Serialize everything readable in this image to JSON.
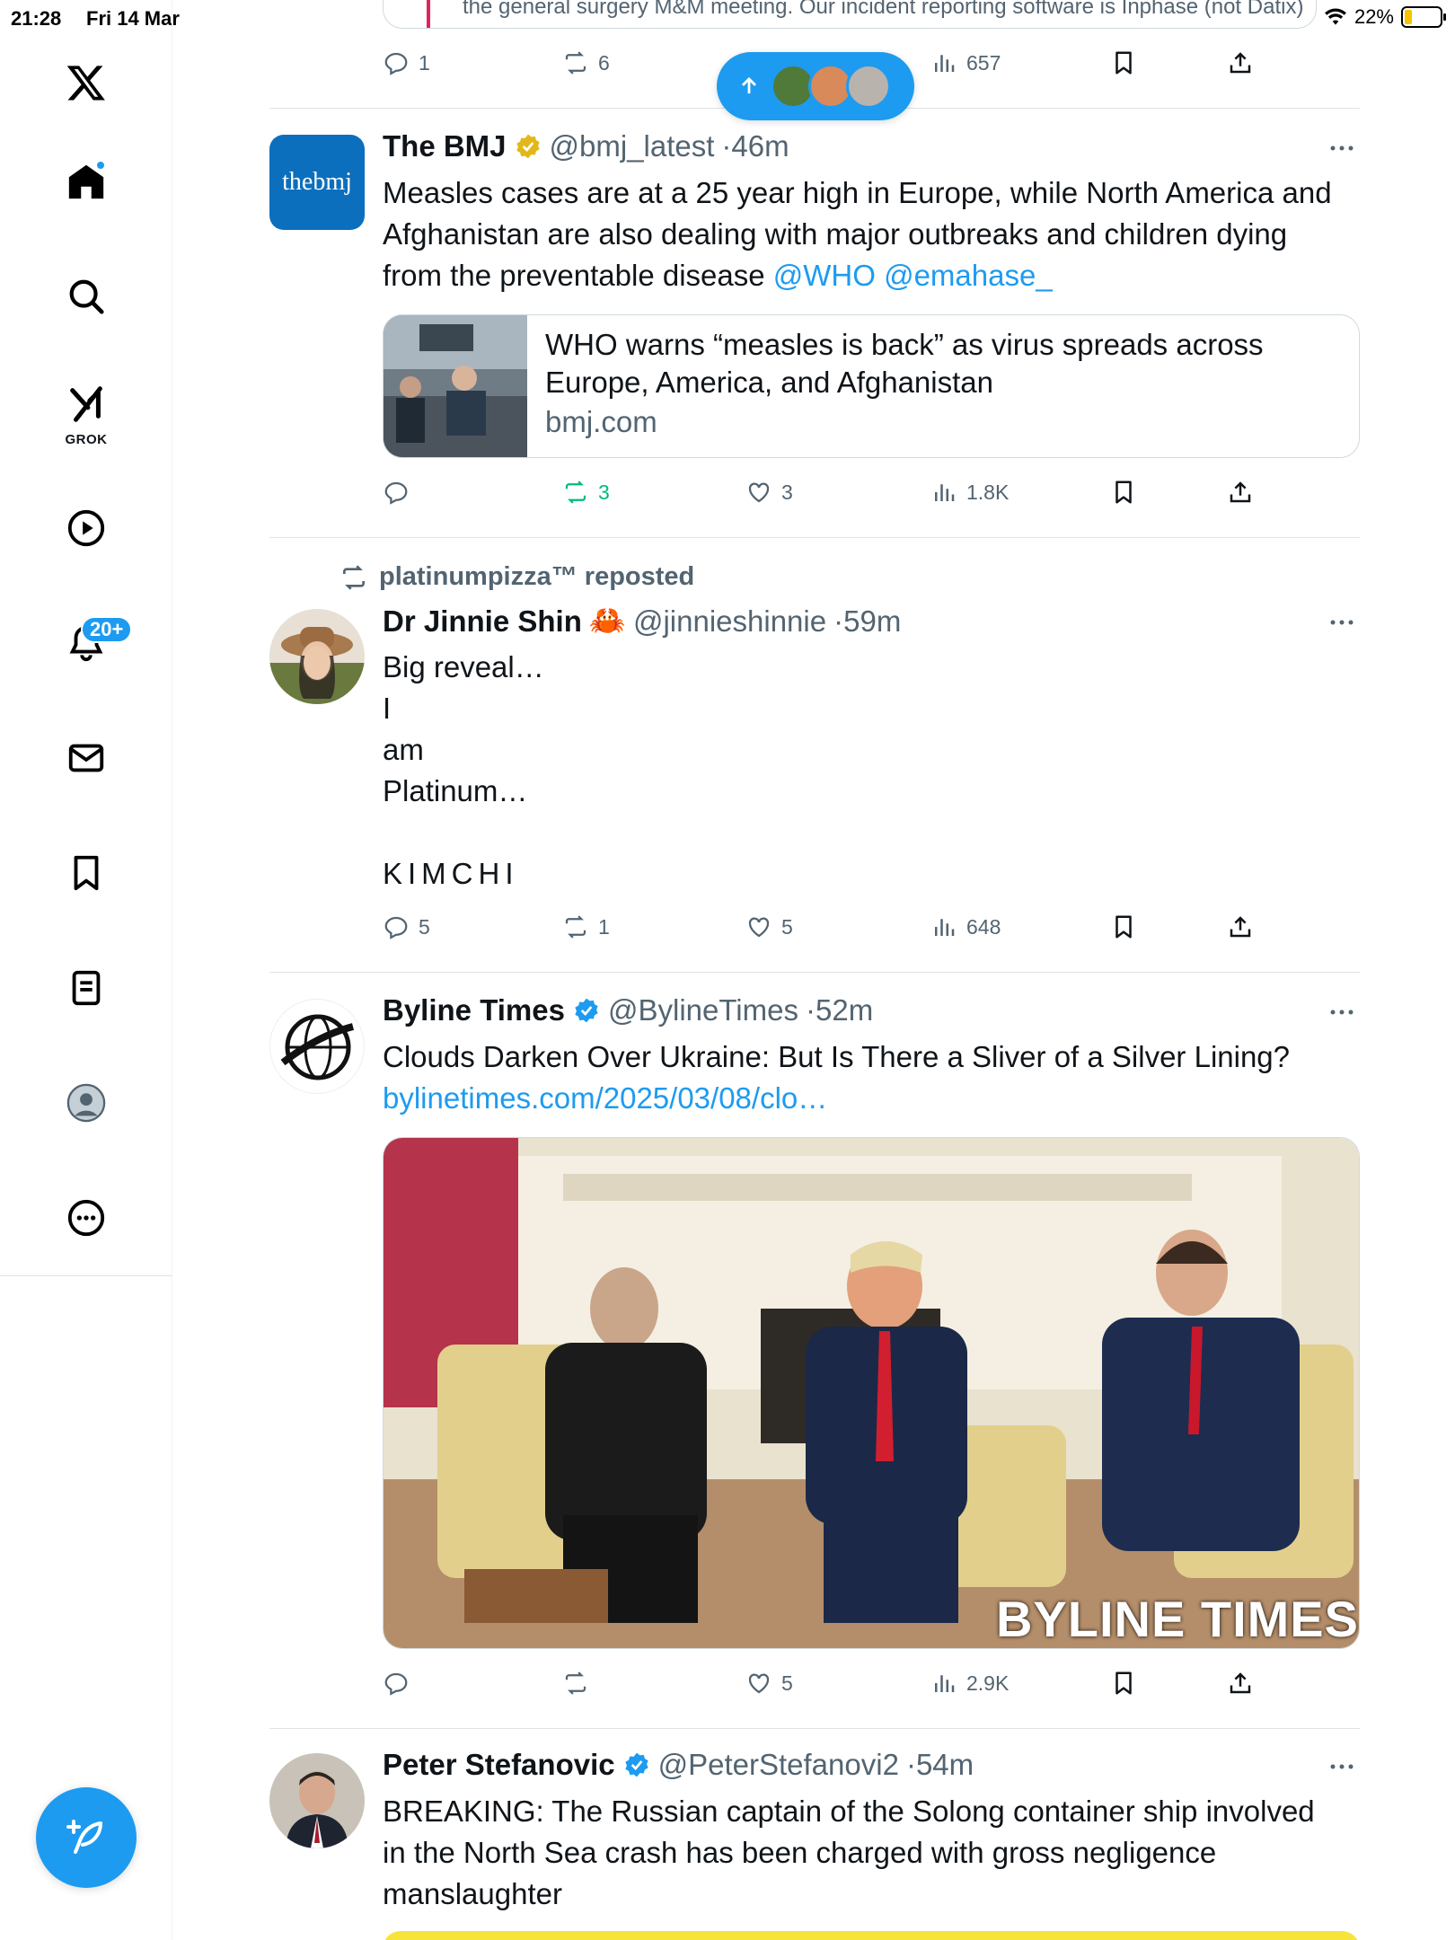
{
  "status_bar": {
    "time": "21:28",
    "date": "Fri 14 Mar",
    "battery": "22%"
  },
  "sidebar": {
    "logo": "x-logo",
    "items": [
      {
        "name": "home",
        "icon": "home-icon"
      },
      {
        "name": "search",
        "icon": "search-icon"
      },
      {
        "name": "grok",
        "icon": "grok-icon",
        "label": "GROK"
      },
      {
        "name": "video",
        "icon": "play-icon"
      },
      {
        "name": "notifications",
        "icon": "bell-icon",
        "badge": "20+"
      },
      {
        "name": "messages",
        "icon": "mail-icon"
      },
      {
        "name": "bookmarks",
        "icon": "bookmark-icon"
      },
      {
        "name": "lists",
        "icon": "list-icon"
      },
      {
        "name": "profile",
        "icon": "profile-icon"
      },
      {
        "name": "more",
        "icon": "more-circle-icon"
      }
    ],
    "compose_icon": "compose-icon"
  },
  "top_tweet": {
    "quote_text": "the general surgery M&M meeting. Our incident reporting software is Inphase (not Datix)",
    "replies": "1",
    "reposts": "6",
    "views": "657"
  },
  "new_posts_pill": {
    "icon": "arrow-up-icon"
  },
  "tweets": [
    {
      "name": "The BMJ",
      "verified": "gold",
      "handle": "@bmj_latest",
      "time": "46m",
      "avatar_text": "thebmj",
      "text_lines": [
        "Measles cases are at a 25 year high in Europe, while North America and",
        "Afghanistan are also dealing with major outbreaks and children dying",
        "from the preventable disease "
      ],
      "mentions": "@WHO @emahase_",
      "card": {
        "title": "WHO warns “measles is back” as virus spreads across Europe, America, and Afghanistan",
        "domain": "bmj.com"
      },
      "replies": "",
      "reposts": "3",
      "likes": "3",
      "views": "1.8K"
    },
    {
      "repost_by": "platinumpizza™ reposted",
      "name": "Dr Jinnie Shin",
      "emoji": "🦀",
      "handle": "@jinnieshinnie",
      "time": "59m",
      "text_lines": [
        "Big reveal…",
        "I",
        "am",
        "Platinum…",
        "",
        "KIMCHI"
      ],
      "replies": "5",
      "reposts": "1",
      "likes": "5",
      "views": "648"
    },
    {
      "name": "Byline Times",
      "verified": "blue",
      "handle": "@BylineTimes",
      "time": "52m",
      "text": "Clouds Darken Over Ukraine: But Is There a Sliver of a Silver Lining?",
      "link": "bylinetimes.com/2025/03/08/clo…",
      "media_watermark": "BYLINE TIMES",
      "replies": "",
      "reposts": "",
      "likes": "5",
      "views": "2.9K"
    },
    {
      "name": "Peter Stefanovic",
      "verified": "blue",
      "handle": "@PeterStefanovi2",
      "time": "54m",
      "text_lines": [
        "BREAKING: The Russian captain of the Solong container ship involved",
        "in the North Sea crash has been charged with gross negligence",
        "manslaughter"
      ]
    }
  ],
  "colors": {
    "accent": "#1d9bf0",
    "repost_green": "#00ba7c",
    "text": "#0f1419",
    "secondary": "#536471",
    "gold": "#e2b719"
  }
}
